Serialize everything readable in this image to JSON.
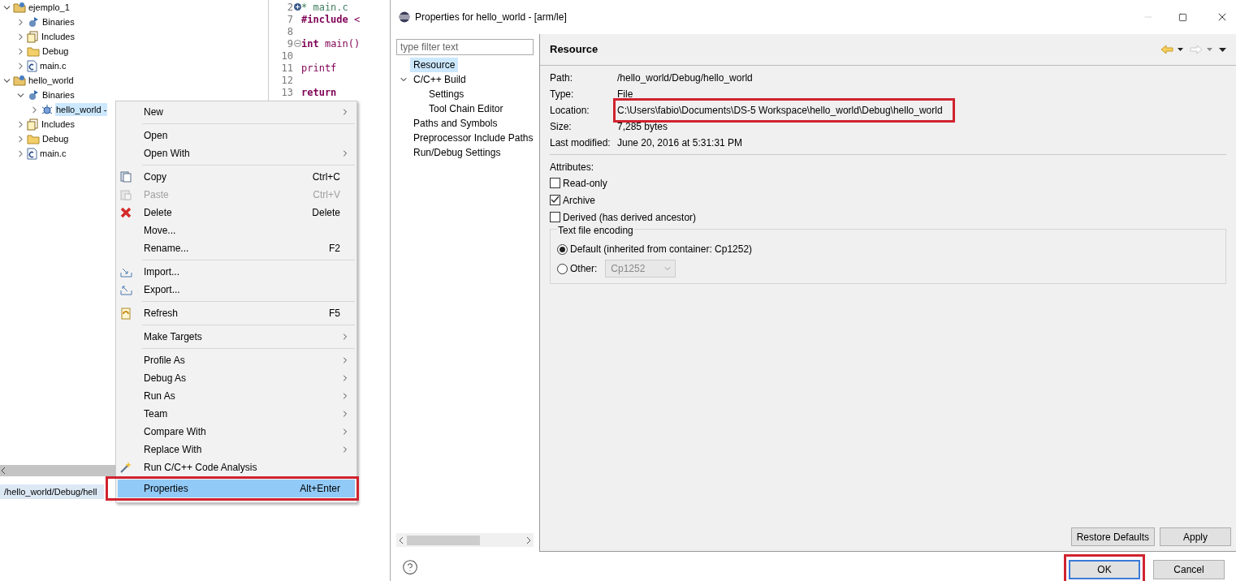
{
  "explorer": {
    "tree": [
      {
        "label": "ejemplo_1",
        "kind": "project",
        "expanded": true,
        "selected": false,
        "children": [
          {
            "label": "Binaries",
            "kind": "binaries",
            "expanded": false,
            "selected": false
          },
          {
            "label": "Includes",
            "kind": "includes",
            "expanded": false,
            "selected": false
          },
          {
            "label": "Debug",
            "kind": "folder",
            "expanded": false,
            "selected": false
          },
          {
            "label": "main.c",
            "kind": "cfile",
            "expanded": false,
            "selected": false
          }
        ]
      },
      {
        "label": "hello_world",
        "kind": "project",
        "expanded": true,
        "selected": false,
        "children": [
          {
            "label": "Binaries",
            "kind": "binaries",
            "expanded": true,
            "selected": false,
            "children": [
              {
                "label": "hello_world -",
                "kind": "binary",
                "expanded": false,
                "selected": true
              }
            ]
          },
          {
            "label": "Includes",
            "kind": "includes",
            "expanded": false,
            "selected": false
          },
          {
            "label": "Debug",
            "kind": "folder",
            "expanded": false,
            "selected": false
          },
          {
            "label": "main.c",
            "kind": "cfile",
            "expanded": false,
            "selected": false
          }
        ]
      }
    ],
    "status_path": "/hello_world/Debug/hell"
  },
  "editor": {
    "lines": [
      {
        "number": "2",
        "collapsed": true,
        "kind": "comment",
        "code": " * main.c"
      },
      {
        "number": "7",
        "kind": "code",
        "code": "**#include** <"
      },
      {
        "number": "8"
      },
      {
        "number": "9",
        "collapsed": false,
        "kind": "code",
        "code": "**int** main()"
      },
      {
        "number": "10"
      },
      {
        "number": "11",
        "kind": "code",
        "code": "    printf"
      },
      {
        "number": "12"
      },
      {
        "number": "13",
        "kind": "code",
        "code": "    **return**"
      }
    ]
  },
  "context_menu": [
    {
      "kind": "item",
      "label": "New",
      "submenu": true,
      "disabled": false,
      "selected": false,
      "highlighted": false
    },
    {
      "kind": "separator"
    },
    {
      "kind": "item",
      "label": "Open",
      "submenu": false,
      "disabled": false,
      "selected": false,
      "highlighted": false
    },
    {
      "kind": "item",
      "label": "Open With",
      "submenu": true,
      "disabled": false,
      "selected": false,
      "highlighted": false
    },
    {
      "kind": "separator"
    },
    {
      "kind": "item",
      "label": "Copy",
      "shortcut": "Ctrl+C",
      "submenu": false,
      "disabled": false,
      "selected": false,
      "highlighted": false
    },
    {
      "kind": "item",
      "label": "Paste",
      "shortcut": "Ctrl+V",
      "submenu": false,
      "disabled": true,
      "selected": false,
      "highlighted": false
    },
    {
      "kind": "item",
      "label": "Delete",
      "shortcut": "Delete",
      "submenu": false,
      "disabled": false,
      "selected": false,
      "highlighted": false
    },
    {
      "kind": "item",
      "label": "Move...",
      "submenu": false,
      "disabled": false,
      "selected": false,
      "highlighted": false
    },
    {
      "kind": "item",
      "label": "Rename...",
      "shortcut": "F2",
      "submenu": false,
      "disabled": false,
      "selected": false,
      "highlighted": false
    },
    {
      "kind": "separator"
    },
    {
      "kind": "item",
      "label": "Import...",
      "submenu": false,
      "disabled": false,
      "selected": false,
      "highlighted": false
    },
    {
      "kind": "item",
      "label": "Export...",
      "submenu": false,
      "disabled": false,
      "selected": false,
      "highlighted": false
    },
    {
      "kind": "separator"
    },
    {
      "kind": "item",
      "label": "Refresh",
      "shortcut": "F5",
      "submenu": false,
      "disabled": false,
      "selected": false,
      "highlighted": false
    },
    {
      "kind": "separator"
    },
    {
      "kind": "item",
      "label": "Make Targets",
      "submenu": true,
      "disabled": false,
      "selected": false,
      "highlighted": false
    },
    {
      "kind": "separator"
    },
    {
      "kind": "item",
      "label": "Profile As",
      "submenu": true,
      "disabled": false,
      "selected": false,
      "highlighted": false
    },
    {
      "kind": "item",
      "label": "Debug As",
      "submenu": true,
      "disabled": false,
      "selected": false,
      "highlighted": false
    },
    {
      "kind": "item",
      "label": "Run As",
      "submenu": true,
      "disabled": false,
      "selected": false,
      "highlighted": false
    },
    {
      "kind": "item",
      "label": "Team",
      "submenu": true,
      "disabled": false,
      "selected": false,
      "highlighted": false
    },
    {
      "kind": "item",
      "label": "Compare With",
      "submenu": true,
      "disabled": false,
      "selected": false,
      "highlighted": false
    },
    {
      "kind": "item",
      "label": "Replace With",
      "submenu": true,
      "disabled": false,
      "selected": false,
      "highlighted": false
    },
    {
      "kind": "item",
      "label": "Run C/C++ Code Analysis",
      "submenu": false,
      "disabled": false,
      "selected": false,
      "highlighted": false
    },
    {
      "kind": "item",
      "label": "Properties",
      "shortcut": "Alt+Enter",
      "submenu": false,
      "disabled": false,
      "selected": true,
      "highlighted": true
    }
  ],
  "dialog": {
    "title": "Properties for hello_world - [arm/le]",
    "filter": {
      "placeholder": "type filter text"
    },
    "nav": [
      {
        "label": "Resource",
        "selected": true
      },
      {
        "label": "C/C++ Build",
        "selected": false,
        "expanded": true,
        "children": [
          {
            "label": "Settings",
            "selected": false
          },
          {
            "label": "Tool Chain Editor",
            "selected": false
          }
        ]
      },
      {
        "label": "Paths and Symbols",
        "selected": false
      },
      {
        "label": "Preprocessor Include Paths",
        "selected": false
      },
      {
        "label": "Run/Debug Settings",
        "selected": false
      }
    ],
    "page_title": "Resource",
    "properties": [
      {
        "label": "Path:",
        "value": "/hello_world/Debug/hello_world",
        "highlighted": false
      },
      {
        "label": "Type:",
        "value": "File",
        "highlighted": false
      },
      {
        "label": "Location:",
        "value": "C:\\Users\\fabio\\Documents\\DS-5 Workspace\\hello_world\\Debug\\hello_world",
        "highlighted": true
      },
      {
        "label": "Size:",
        "value": "7,285  bytes",
        "highlighted": false
      },
      {
        "label": "Last modified:",
        "value": "June 20, 2016 at 5:31:31 PM",
        "highlighted": false
      }
    ],
    "attributes_label": "Attributes:",
    "attributes": [
      {
        "label": "Read-only",
        "checked": false
      },
      {
        "label": "Archive",
        "checked": true
      },
      {
        "label": "Derived (has derived ancestor)",
        "checked": false
      }
    ],
    "encoding": {
      "title": "Text file encoding",
      "options": [
        {
          "label": "Default (inherited from container: Cp1252)",
          "selected": true
        },
        {
          "label": "Other:",
          "selected": false,
          "combo": {
            "value": "Cp1252",
            "disabled": true
          }
        }
      ]
    },
    "page_buttons": [
      "Restore Defaults",
      "Apply"
    ],
    "footer_buttons": [
      {
        "label": "OK",
        "default": true,
        "highlighted": true
      },
      {
        "label": "Cancel",
        "default": false,
        "highlighted": false
      }
    ]
  }
}
